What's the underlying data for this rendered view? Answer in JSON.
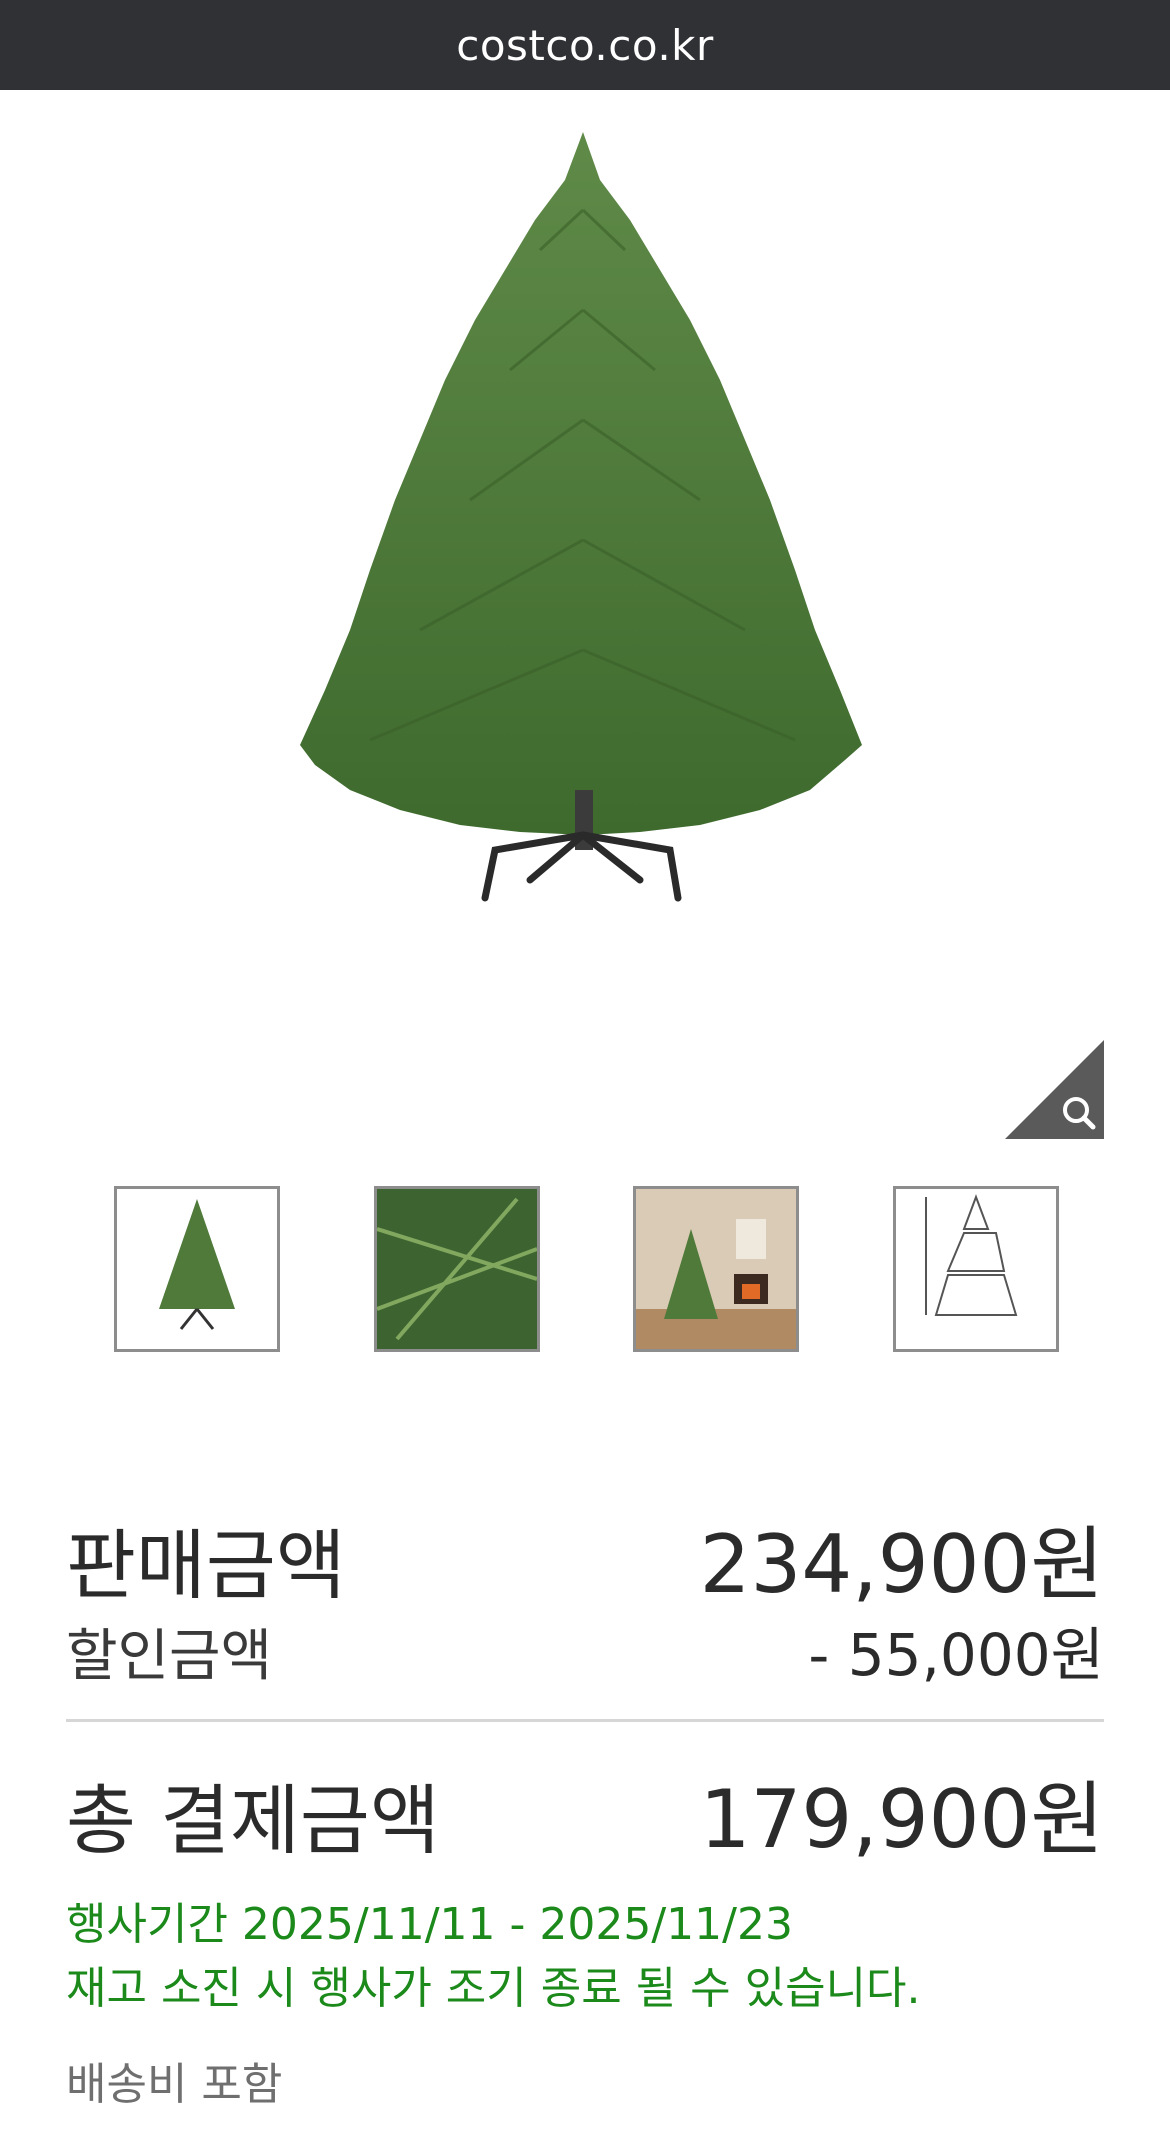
{
  "browser": {
    "url": "costco.co.kr"
  },
  "product": {
    "image_alt": "Christmas tree",
    "zoom_icon": "magnifier-icon",
    "thumbnails": [
      "tree-full",
      "branch-closeup",
      "room-scene",
      "size-diagram"
    ]
  },
  "pricing": {
    "sale_label": "판매금액",
    "sale_value": "234,900원",
    "discount_label": "할인금액",
    "discount_value": "- 55,000원",
    "total_label": "총 결제금액",
    "total_value": "179,900원"
  },
  "promo": {
    "period": "행사기간 2025/11/11 - 2025/11/23",
    "notice": "재고 소진 시 행사가 조기 종료 될 수 있습니다."
  },
  "shipping": {
    "note": "배송비 포함"
  },
  "colors": {
    "accent_green": "#1b8a1b",
    "bar": "#2f3135",
    "tree": "#4f7a3a"
  }
}
